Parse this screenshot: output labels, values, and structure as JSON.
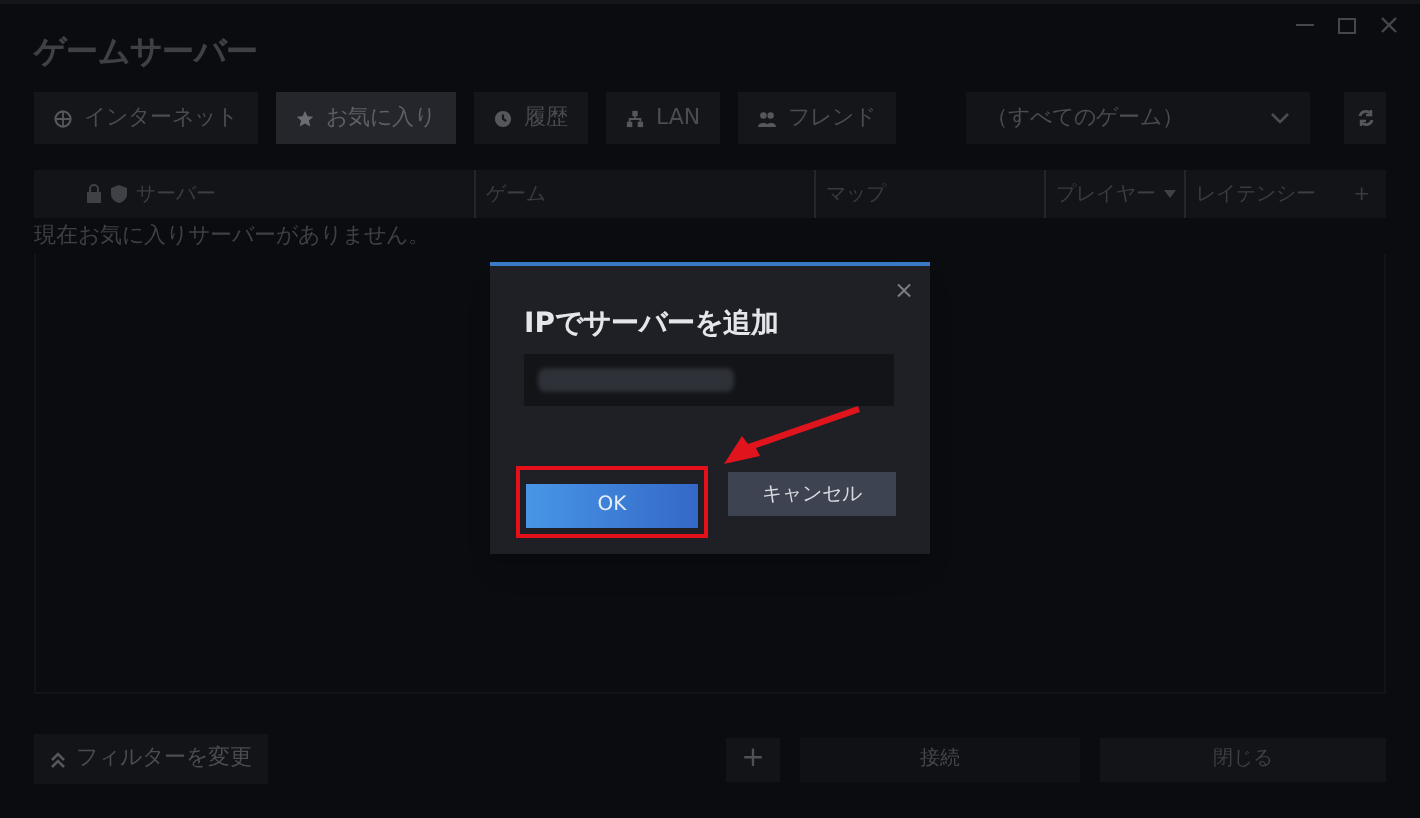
{
  "window": {
    "title": "ゲームサーバー"
  },
  "tabs": [
    {
      "label": "インターネット",
      "kind": "globe",
      "selected": false
    },
    {
      "label": "お気に入り",
      "kind": "star",
      "selected": true
    },
    {
      "label": "履歴",
      "kind": "clock",
      "selected": false
    },
    {
      "label": "LAN",
      "kind": "lan",
      "selected": false
    },
    {
      "label": "フレンド",
      "kind": "friends",
      "selected": false
    }
  ],
  "game_filter": {
    "value": "（すべてのゲーム）"
  },
  "table": {
    "columns": [
      {
        "label": "サーバー",
        "kind": "server"
      },
      {
        "label": "ゲーム",
        "kind": "plain"
      },
      {
        "label": "マップ",
        "kind": "plain"
      },
      {
        "label": "プレイヤー",
        "kind": "sorted"
      },
      {
        "label": "レイテンシー",
        "kind": "plain"
      }
    ],
    "add_column": "+",
    "empty_message": "現在お気に入りサーバーがありません。"
  },
  "footer": {
    "filter_button": "フィルターを変更",
    "add_button": "+",
    "connect_button": "接続",
    "close_button": "閉じる"
  },
  "dialog": {
    "title": "IPでサーバーを追加",
    "close": "×",
    "ok_button": "OK",
    "cancel_button": "キャンセル",
    "ok_highlighted": true
  }
}
